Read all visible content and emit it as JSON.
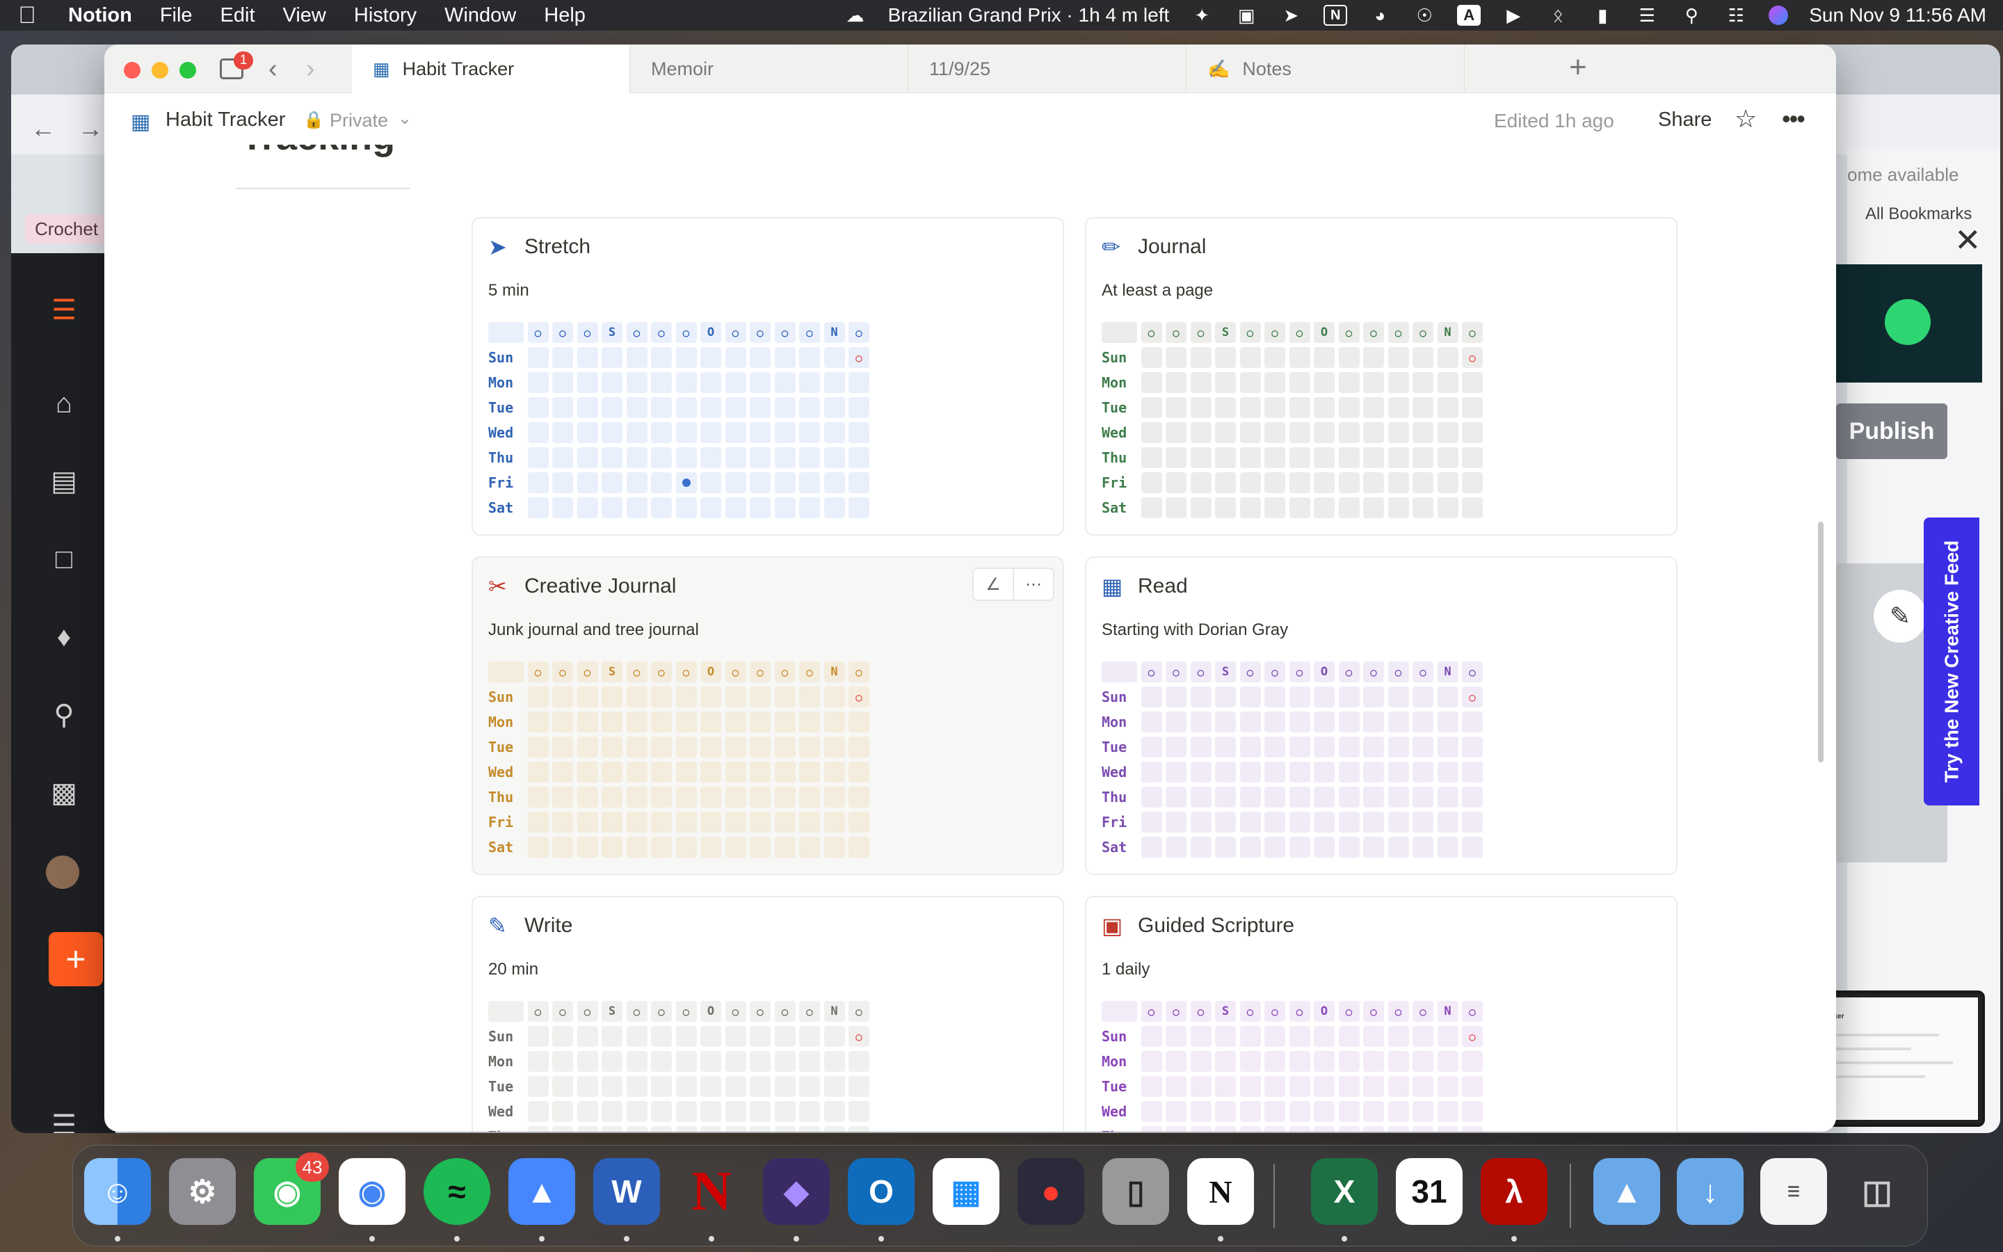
{
  "menubar": {
    "app_name": "Notion",
    "menus": [
      "File",
      "Edit",
      "View",
      "History",
      "Window",
      "Help"
    ],
    "now_playing": "Brazilian Grand Prix · 1h 4 m left",
    "clock": "Sun Nov 9  11:56 AM",
    "status_icons": [
      "creative-cloud-icon",
      "sparkle-icon",
      "screenshot-icon",
      "bird-icon",
      "n-icon",
      "arc-icon",
      "accessibility-icon",
      "keyboard-a-icon",
      "play-icon",
      "bluetooth-icon",
      "battery-icon",
      "wifi-icon",
      "search-icon",
      "control-center-icon",
      "siri-icon"
    ],
    "keyboard_label": "A"
  },
  "background_browser": {
    "bookmarks_label": "All Bookmarks",
    "available_text": "ome available",
    "bookmark_chip": "Crochet",
    "publish_label": "Publish",
    "feed_banner": "Try the New Creative Feed",
    "pip_title": "Habit Tracker"
  },
  "notion": {
    "tabs": [
      {
        "label": "Habit Tracker",
        "active": true,
        "icon": "grid-icon"
      },
      {
        "label": "Memoir",
        "active": false,
        "icon": ""
      },
      {
        "label": "11/9/25",
        "active": false,
        "icon": ""
      },
      {
        "label": "Notes",
        "active": false,
        "icon": "notes-icon"
      }
    ],
    "sidebar_badge": "1",
    "breadcrumb": {
      "title": "Habit Tracker",
      "privacy": "Private"
    },
    "edited": "Edited 1h ago",
    "share_label": "Share",
    "heading_cut": "Tracking"
  },
  "habit_grid": {
    "header": [
      "○",
      "○",
      "○",
      "S",
      "○",
      "○",
      "○",
      "O",
      "○",
      "○",
      "○",
      "○",
      "N",
      "○"
    ],
    "days": [
      "Sun",
      "Mon",
      "Tue",
      "Wed",
      "Thu",
      "Fri",
      "Sat"
    ]
  },
  "cards": [
    {
      "title": "Stretch",
      "subtitle": "5 min",
      "icon": "runner-icon",
      "theme": "blue",
      "marked": [
        [
          5,
          6
        ]
      ]
    },
    {
      "title": "Journal",
      "subtitle": "At least a page",
      "icon": "pencil-icon",
      "theme": "green",
      "marked": []
    },
    {
      "title": "Creative Journal",
      "subtitle": "Junk journal and tree journal",
      "icon": "scissors-icon",
      "theme": "orange",
      "marked": []
    },
    {
      "title": "Read",
      "subtitle": "Starting with Dorian Gray",
      "icon": "book-icon",
      "theme": "purple",
      "marked": []
    },
    {
      "title": "Write",
      "subtitle": "20 min",
      "icon": "edit-icon",
      "theme": "gray",
      "marked": []
    },
    {
      "title": "Guided Scripture",
      "subtitle": "1 daily",
      "icon": "red-book-icon",
      "theme": "violet",
      "marked": []
    }
  ],
  "themes": {
    "blue": {
      "cell": "#e9f0fb",
      "text": "#2f63b5"
    },
    "green": {
      "cell": "#ececea",
      "text": "#3d7d4a"
    },
    "orange": {
      "cell": "#f4ecdc",
      "text": "#c58a2a"
    },
    "purple": {
      "cell": "#f1ebf8",
      "text": "#7a4bb0"
    },
    "gray": {
      "cell": "#f0f0ee",
      "text": "#6b6b68"
    },
    "violet": {
      "cell": "#f3ebf8",
      "text": "#8a45b8"
    }
  },
  "dock": {
    "apps": [
      "finder-icon",
      "system-settings-icon",
      "messages-icon",
      "chrome-icon",
      "spotify-icon",
      "nordvpn-icon",
      "word-icon",
      "nebraska-icon",
      "obsidian-icon",
      "outlook-icon",
      "windows-app-icon",
      "joystick-icon",
      "iphone-mirroring-icon",
      "notion-icon",
      "excel-icon",
      "calendar-icon",
      "acrobat-icon",
      "app-folder-icon",
      "downloads-folder-icon",
      "recent-doc-icon",
      "trash-icon"
    ],
    "messages_badge": "43",
    "calendar_day": "31"
  }
}
